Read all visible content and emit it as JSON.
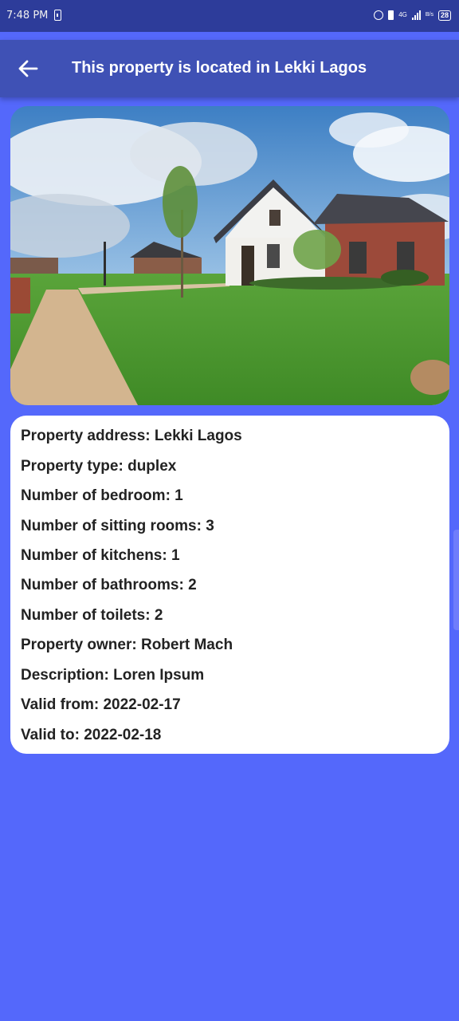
{
  "status_bar": {
    "time": "7:48 PM",
    "network": "4G",
    "speed": "B/s",
    "battery": "28"
  },
  "app_bar": {
    "back_icon": "arrow-left-icon",
    "title": "This property is located in Lekki Lagos"
  },
  "photo": {
    "description": "house-photo"
  },
  "details": [
    {
      "label": "Property address",
      "value": "Lekki Lagos"
    },
    {
      "label": "Property type",
      "value": "duplex"
    },
    {
      "label": "Number of bedroom",
      "value": "1"
    },
    {
      "label": "Number of sitting rooms",
      "value": "3"
    },
    {
      "label": "Number of kitchens",
      "value": "1"
    },
    {
      "label": "Number of bathrooms",
      "value": "2"
    },
    {
      "label": "Number of toilets",
      "value": "2"
    },
    {
      "label": "Property owner",
      "value": "Robert Mach"
    },
    {
      "label": "Description",
      "value": "Loren Ipsum"
    },
    {
      "label": "Valid from",
      "value": "2022-02-17"
    },
    {
      "label": "Valid to",
      "value": "2022-02-18"
    }
  ],
  "colors": {
    "background": "#5468fb",
    "app_bar": "#3f51b5",
    "status_bar": "#2d3c9a",
    "card": "#ffffff"
  }
}
